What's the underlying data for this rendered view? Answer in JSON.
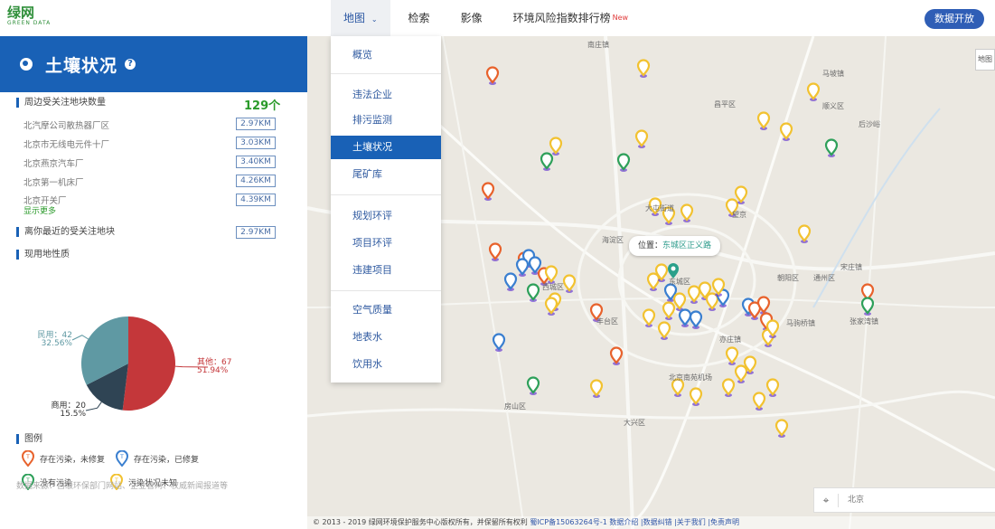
{
  "app": {
    "logo": "绿网",
    "logo_sub": "GREEN DATA"
  },
  "nav": {
    "items": [
      {
        "label": "地图",
        "chevron": "chevron-down-icon",
        "active": true
      },
      {
        "label": "检索"
      },
      {
        "label": "影像"
      },
      {
        "label": "环境风险指数排行榜",
        "badge": "New"
      }
    ],
    "open_data_button": "数据开放"
  },
  "dropdown": {
    "items": [
      "概览",
      "违法企业",
      "排污监测",
      "土壤状况",
      "尾矿库",
      "规划环评",
      "项目环评",
      "违建项目",
      "空气质量",
      "地表水",
      "饮用水"
    ],
    "selected": "土壤状况"
  },
  "panel": {
    "title": "土壤状况",
    "help_icon": "question-circle-icon",
    "nearby_title": "周边受关注地块数量",
    "nearby_count": "129个",
    "sites": [
      {
        "name": "北汽摩公司散热器厂区",
        "dist": "2.97KM"
      },
      {
        "name": "北京市无线电元件十厂",
        "dist": "3.03KM"
      },
      {
        "name": "北京燕京汽车厂",
        "dist": "3.40KM"
      },
      {
        "name": "北京第一机床厂",
        "dist": "4.26KM"
      },
      {
        "name": "北京开关厂",
        "dist": "4.39KM"
      }
    ],
    "show_more": "显示更多",
    "nearest_title": "离你最近的受关注地块",
    "nearest_dist": "2.97KM",
    "landuse_title": "现用地性质",
    "legend_title": "图例",
    "legend": [
      {
        "label": "存在污染，未修复",
        "color": "#e8622c"
      },
      {
        "label": "存在污染，已修复",
        "color": "#3a7fd0"
      },
      {
        "label": "没有污染",
        "color": "#2ea05a"
      },
      {
        "label": "污染状况未知",
        "color": "#f2c230"
      }
    ],
    "source": "数据来源：自级环保部门网站、企业官网、权威新闻报道等"
  },
  "chart_data": {
    "type": "pie",
    "slices": [
      {
        "label": "其他",
        "value": 67,
        "pct": "51.94%",
        "color": "#c4373a"
      },
      {
        "label": "商用",
        "value": 20,
        "pct": "15.5%",
        "color": "#2f4454"
      },
      {
        "label": "民用",
        "value": 42,
        "pct": "32.56%",
        "color": "#5f99a3"
      }
    ]
  },
  "map": {
    "tooltip_prefix": "位置：",
    "tooltip_value": "东城区正义路",
    "maptype_label": "地图",
    "search_placeholder": "北京",
    "labels": [
      "南庄镇",
      "西营镇",
      "昌平区",
      "延庆路",
      "顺义区",
      "后沙峪",
      "马坡镇",
      "望京",
      "大屯街道",
      "东城区",
      "朝阳区",
      "海淀区",
      "西城区",
      "通州区",
      "丰台区",
      "大兴区",
      "房山区",
      "北京南苑机场",
      "亦庄镇",
      "宋庄镇",
      "马驹桥镇",
      "张家湾镇"
    ],
    "footer_text": "© 2013 - 2019 绿网环境保护服务中心版权所有，并保留所有权利",
    "footer_links": "蜀ICP备15063264号-1 数据介绍 |数据纠错 |关于我们 |免责声明"
  }
}
